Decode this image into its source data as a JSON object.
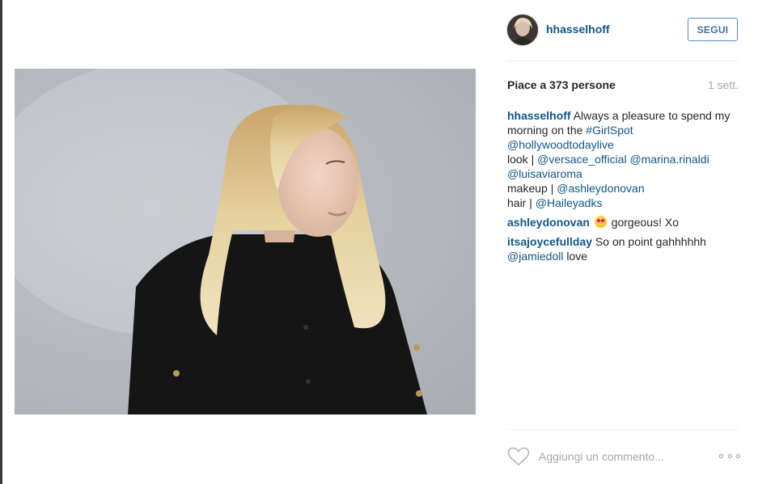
{
  "post": {
    "author": "hhasselhoff",
    "follow_label": "SEGUI",
    "likes_text": "Piace a 373 persone",
    "time_ago": "1 sett.",
    "photo_alt": "photo"
  },
  "comments": [
    {
      "user": "hhasselhoff",
      "lines": [
        {
          "text": " Always a pleasure to spend my morning on the ",
          "link": "#GirlSpot"
        },
        {
          "link": "@hollywoodtodaylive"
        },
        {
          "text": "look | ",
          "link": "@versace_official",
          "link2": "@marina.rinaldi"
        },
        {
          "link": "@luisaviaroma"
        },
        {
          "text": "makeup | ",
          "link": "@ashleydonovan"
        },
        {
          "text": "hair | ",
          "link": "@Haileyadks"
        }
      ]
    },
    {
      "user": "ashleydonovan",
      "text": " gorgeous! Xo"
    },
    {
      "user": "itsajoycefullday",
      "text": " So on point gahhhhhh",
      "mention": "@jamiedoll",
      "text2": " love"
    }
  ],
  "comment_box": {
    "placeholder": "Aggiungi un commento..."
  },
  "icons": {
    "heart": "heart-icon",
    "more": "more-options-icon",
    "emoji": "heart-eyes-emoji-icon"
  },
  "colors": {
    "link": "#125688",
    "follow_border": "#4e8ac4",
    "muted": "#a5a7aa"
  }
}
